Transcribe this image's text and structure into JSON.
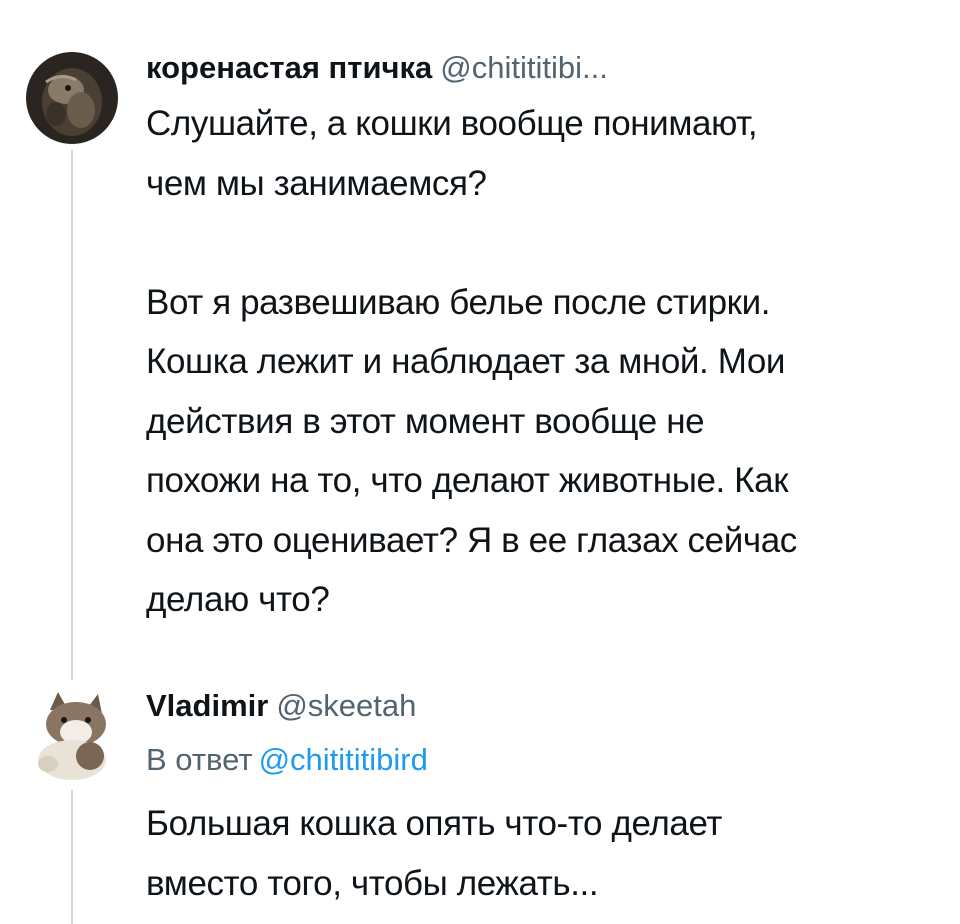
{
  "thread": {
    "tweets": [
      {
        "display_name": "коренастая птичка",
        "handle": "@chitititibi...",
        "avatar_icon": "bird-photo-avatar",
        "text": "Слушайте, а кошки вообще понимают,\nчем мы занимаемся?\n\nВот я развешиваю белье после стирки.\nКошка лежит и наблюдает за мной. Мои\nдействия в этот момент вообще не\nпохожи на то, что делают животные. Как\nона это оценивает? Я в ее глазах сейчас\nделаю что?"
      },
      {
        "display_name": "Vladimir",
        "handle": "@skeetah",
        "avatar_icon": "cat-avatar",
        "reply_prefix": "В ответ",
        "reply_to": "@chitititibird",
        "text": "Большая кошка опять что-то делает\nвместо того, чтобы лежать..."
      }
    ]
  },
  "colors": {
    "primary_text": "#0f1419",
    "secondary_text": "#536471",
    "link": "#1d9bf0",
    "thread_line": "#cfd9de"
  }
}
